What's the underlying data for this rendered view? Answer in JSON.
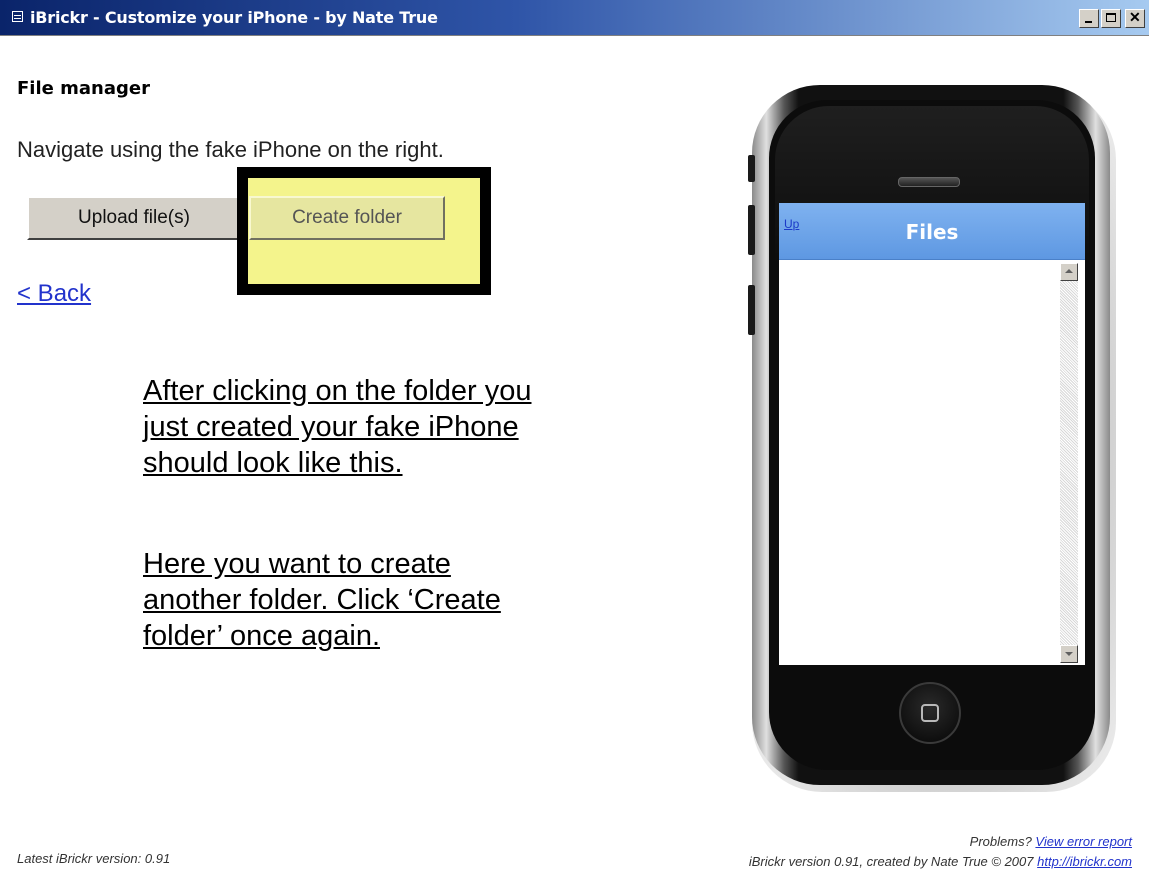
{
  "window": {
    "title": "iBrickr - Customize your iPhone - by Nate True"
  },
  "page": {
    "heading": "File manager",
    "instruction": "Navigate using the fake iPhone on the right.",
    "buttons": {
      "upload": "Upload file(s)",
      "create_folder": "Create folder"
    },
    "back_link": "< Back",
    "highlight_color": "#f4f48c"
  },
  "annotation": {
    "note1": "After clicking on the folder you\njust created your fake iPhone\nshould look like this.",
    "note2": "Here you want to create\nanother folder.  Click ‘Create\nfolder’ once again."
  },
  "phone": {
    "nav_up": "Up",
    "nav_title": "Files",
    "nav_color": "#6ea6ea"
  },
  "footer": {
    "latest_version": "Latest iBrickr version: 0.91",
    "problems_label": "Problems?",
    "error_report_link": "View error report",
    "credit": "iBrickr version 0.91, created by Nate True © 2007",
    "site_link": "http://ibrickr.com"
  }
}
